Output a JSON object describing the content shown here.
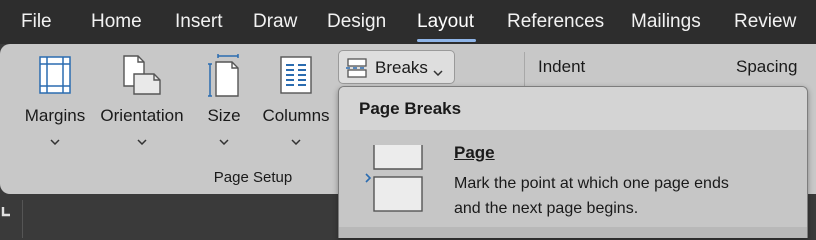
{
  "menu": {
    "tabs": [
      "File",
      "Home",
      "Insert",
      "Draw",
      "Design",
      "Layout",
      "References",
      "Mailings",
      "Review"
    ],
    "active": "Layout"
  },
  "page_setup": {
    "margins": "Margins",
    "orientation": "Orientation",
    "size": "Size",
    "columns": "Columns",
    "group_label": "Page Setup"
  },
  "breaks": {
    "label": "Breaks"
  },
  "paragraph": {
    "indent": "Indent",
    "spacing": "Spacing"
  },
  "dropdown": {
    "header": "Page Breaks",
    "items": [
      {
        "title": "Page",
        "description_line1": "Mark the point at which one page ends",
        "description_line2": "and the next page begins."
      }
    ]
  },
  "colors": {
    "menubar_bg": "#2d2d2d",
    "ribbon_bg": "#c8c8c8",
    "accent_underline": "#8fb5e8",
    "icon_blue": "#2b6cb0",
    "dropdown_highlight": "#c6c6c6"
  },
  "icons": [
    "margins-icon",
    "orientation-icon",
    "size-icon",
    "columns-icon",
    "breaks-icon",
    "page-break-icon",
    "chevron-down-icon",
    "selection-marker-icon"
  ]
}
